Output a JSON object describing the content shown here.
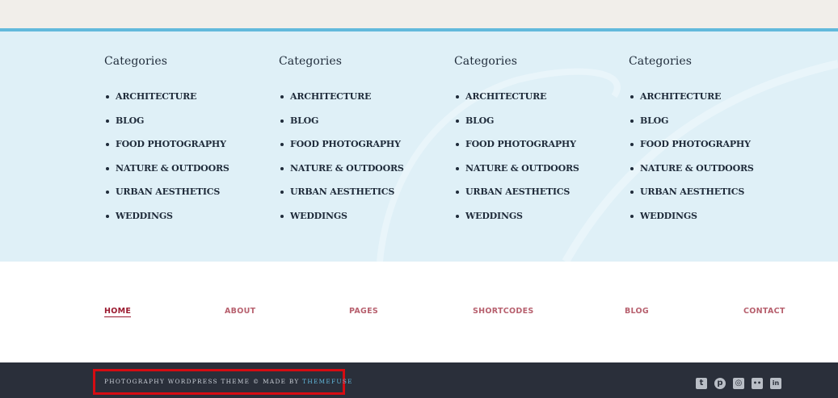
{
  "widgets": {
    "columns": [
      {
        "title": "Categories",
        "items": [
          "ARCHITECTURE",
          "BLOG",
          "FOOD PHOTOGRAPHY",
          "NATURE & OUTDOORS",
          "URBAN AESTHETICS",
          "WEDDINGS"
        ]
      },
      {
        "title": "Categories",
        "items": [
          "ARCHITECTURE",
          "BLOG",
          "FOOD PHOTOGRAPHY",
          "NATURE & OUTDOORS",
          "URBAN AESTHETICS",
          "WEDDINGS"
        ]
      },
      {
        "title": "Categories",
        "items": [
          "ARCHITECTURE",
          "BLOG",
          "FOOD PHOTOGRAPHY",
          "NATURE & OUTDOORS",
          "URBAN AESTHETICS",
          "WEDDINGS"
        ]
      },
      {
        "title": "Categories",
        "items": [
          "ARCHITECTURE",
          "BLOG",
          "FOOD PHOTOGRAPHY",
          "NATURE & OUTDOORS",
          "URBAN AESTHETICS",
          "WEDDINGS"
        ]
      }
    ]
  },
  "nav": {
    "items": [
      "HOME",
      "ABOUT",
      "PAGES",
      "SHORTCODES",
      "BLOG",
      "CONTACT"
    ],
    "active": "HOME"
  },
  "footer": {
    "credit_text": "PHOTOGRAPHY WORDPRESS THEME © MADE BY ",
    "credit_link": "THEMEFUSE",
    "social_icons": [
      {
        "name": "tumblr-icon",
        "glyph": "t"
      },
      {
        "name": "pinterest-icon",
        "glyph": "p"
      },
      {
        "name": "instagram-icon",
        "glyph": "◎"
      },
      {
        "name": "flickr-icon",
        "glyph": "••"
      },
      {
        "name": "linkedin-icon",
        "glyph": "in"
      }
    ]
  },
  "colors": {
    "accent": "#62b9dc",
    "nav_link": "#b7606e",
    "nav_active": "#9b1b30",
    "highlight_box": "#d50c12",
    "footer_bg": "#2a2f3a",
    "widgets_bg": "#dff0f7"
  }
}
